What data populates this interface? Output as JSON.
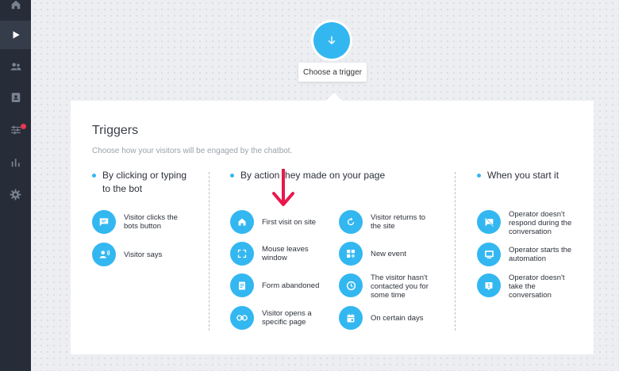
{
  "sidebar": {
    "items": [
      {
        "icon": "home-icon"
      },
      {
        "icon": "play-icon"
      },
      {
        "icon": "users-icon"
      },
      {
        "icon": "contacts-book-icon"
      },
      {
        "icon": "sliders-icon"
      },
      {
        "icon": "bar-chart-icon"
      },
      {
        "icon": "gear-icon"
      }
    ]
  },
  "trigger_button": {
    "icon": "arrow-down-icon",
    "tooltip": "Choose a trigger"
  },
  "panel": {
    "title": "Triggers",
    "subtitle": "Choose how your visitors will be engaged by the chatbot.",
    "columns": [
      {
        "heading_line1": "By clicking or typing",
        "heading_line2": "to the bot",
        "items": [
          {
            "line1": "Visitor clicks the",
            "line2": "bots button",
            "line3": "",
            "icon": "chat-icon"
          },
          {
            "line1": "Visitor says",
            "line2": "",
            "line3": "",
            "icon": "person-speaking-icon"
          }
        ]
      },
      {
        "heading": "By action they made on your page",
        "items": [
          {
            "line1": "First visit on site",
            "line2": "",
            "line3": "",
            "icon": "home-icon"
          },
          {
            "line1": "Mouse leaves",
            "line2": "window",
            "line3": "",
            "icon": "fullscreen-icon"
          },
          {
            "line1": "Form abandoned",
            "line2": "",
            "line3": "",
            "icon": "form-icon"
          },
          {
            "line1": "Visitor opens a",
            "line2": "specific page",
            "line3": "",
            "icon": "link-icon"
          }
        ]
      },
      {
        "items": [
          {
            "line1": "Visitor returns to",
            "line2": "the site",
            "line3": "",
            "icon": "refresh-icon"
          },
          {
            "line1": "New event",
            "line2": "",
            "line3": "",
            "icon": "grid-plus-icon"
          },
          {
            "line1": "The visitor hasn't",
            "line2": "contacted you for",
            "line3": "some time",
            "icon": "clock-icon"
          },
          {
            "line1": "On certain days",
            "line2": "",
            "line3": "",
            "icon": "calendar-icon"
          }
        ]
      },
      {
        "heading": "When you start it",
        "items": [
          {
            "line1": "Operator doesn't",
            "line2": "respond during the",
            "line3": "conversation",
            "icon": "chat-off-icon"
          },
          {
            "line1": "Operator starts the",
            "line2": "automation",
            "line3": "",
            "icon": "monitor-icon"
          },
          {
            "line1": "Operator doesn't",
            "line2": "take the",
            "line3": "conversation",
            "icon": "alert-icon"
          }
        ]
      }
    ]
  },
  "annotation": {
    "icon": "red-arrow-down-icon",
    "color": "#e8184b"
  },
  "colors": {
    "accent": "#33b7f1",
    "sidebar": "#262c38",
    "badge": "#e8384f"
  }
}
